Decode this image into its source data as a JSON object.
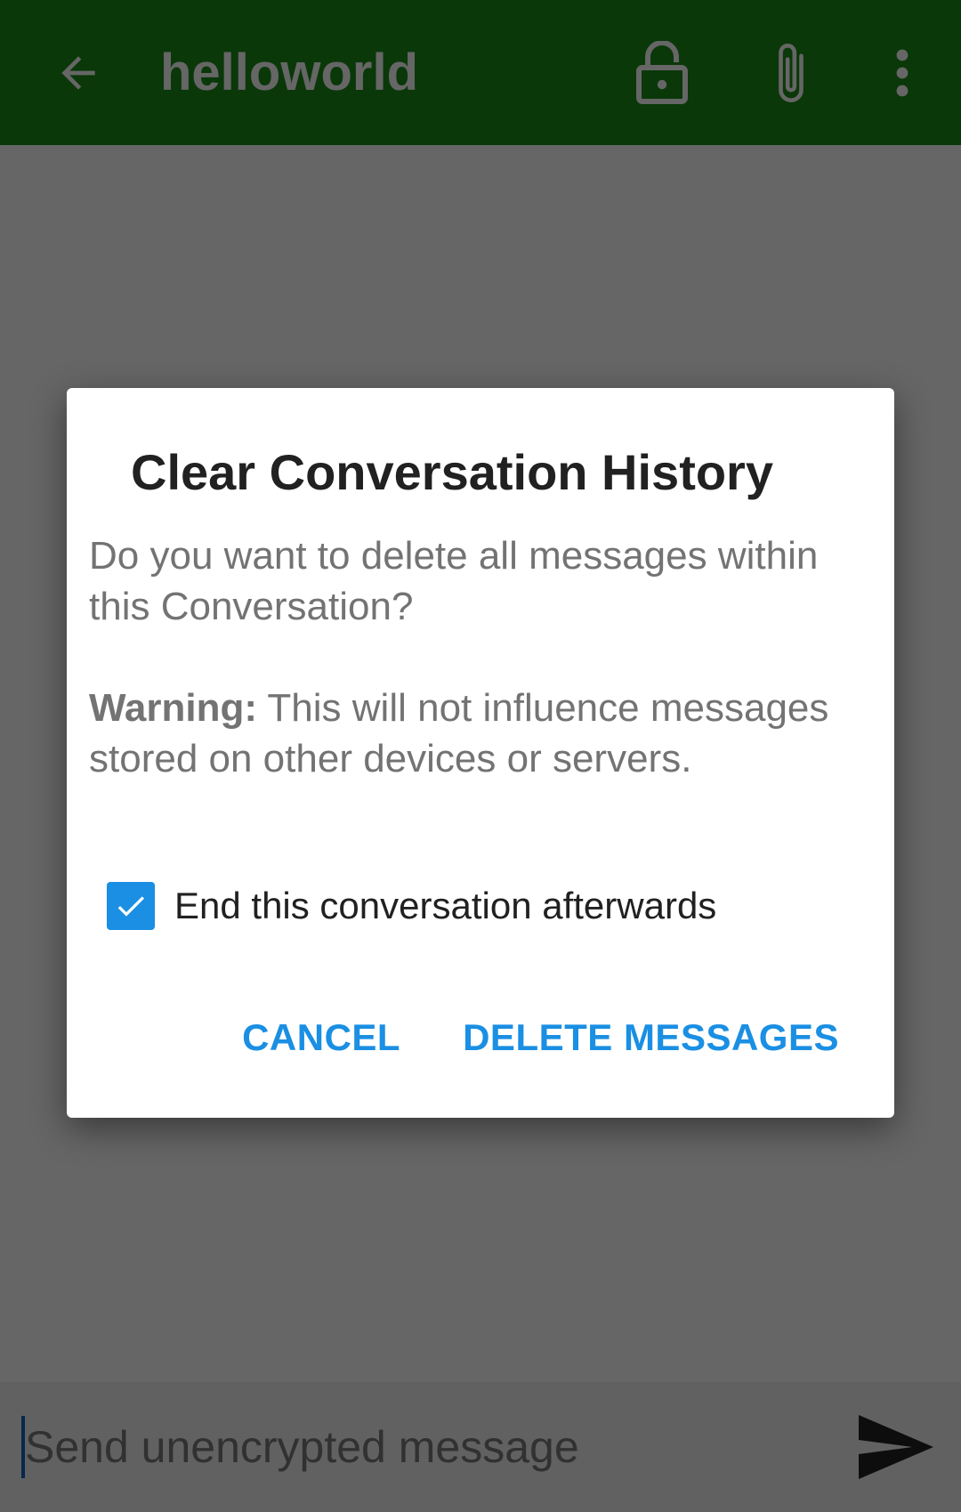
{
  "app_bar": {
    "title": "helloworld",
    "back_icon": "arrow-left-icon",
    "lock_icon": "lock-open-icon",
    "attach_icon": "paperclip-icon",
    "more_icon": "more-vertical-icon",
    "color": "#1b8c17"
  },
  "composer": {
    "placeholder": "Send unencrypted message",
    "send_icon": "send-icon"
  },
  "dialog": {
    "title": "Clear Conversation History",
    "question": "Do you want to delete all messages within this Conversation?",
    "warning_label": "Warning:",
    "warning_text": " This will not influence messages stored on other devices or servers.",
    "checkbox": {
      "label": "End this conversation afterwards",
      "checked": true
    },
    "buttons": {
      "cancel": "CANCEL",
      "delete": "DELETE MESSAGES"
    },
    "accent_color": "#1a8fe3"
  }
}
